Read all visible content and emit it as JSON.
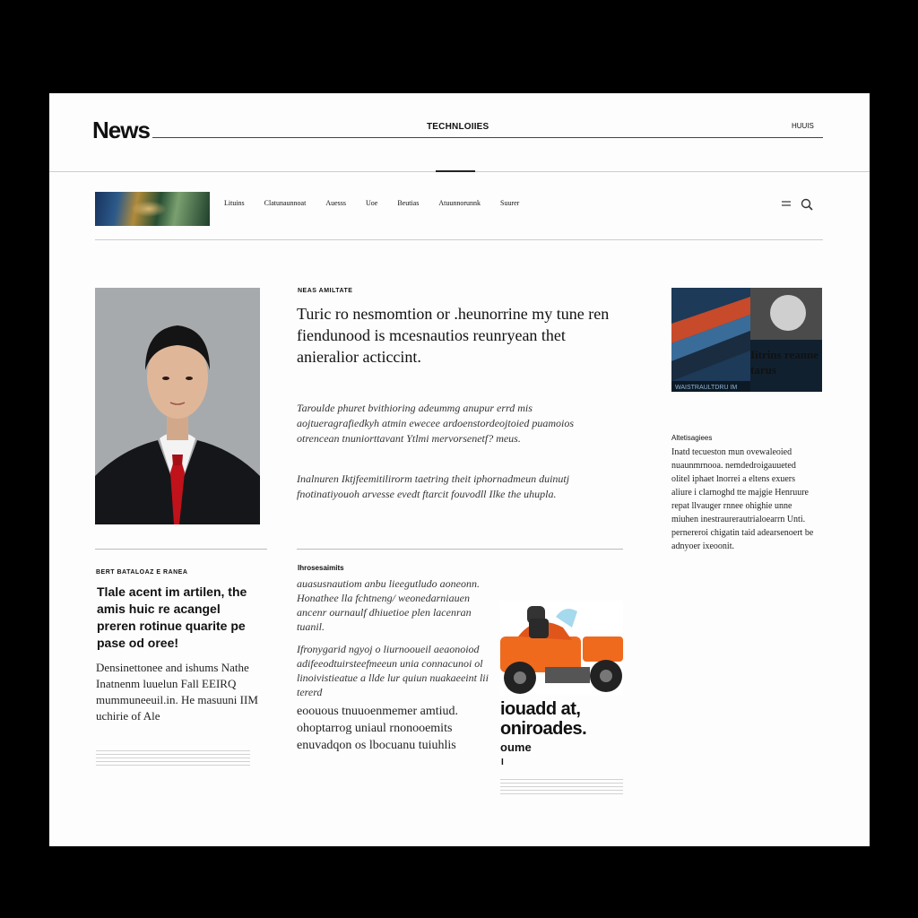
{
  "masthead": {
    "logo": "News",
    "section": "TECHNLOIIES",
    "right_label": "HUUIS"
  },
  "nav": {
    "items": [
      "Lituins",
      "Clatunaunnoat",
      "Auesss",
      "Uoe",
      "Beutias",
      "Atuunnorunnk",
      "Suurer"
    ],
    "menu_icon": "menu-icon",
    "search_icon": "search-icon"
  },
  "lead": {
    "kicker": "NEAS AMILTATE",
    "headline": "Turic ro nesmomtion or .heunorrine my tune ren fiendunood  is mcesnautios reunryean thet anieralior acticcint.",
    "summary": "Taroulde phuret bvithioring adeummg anupur errd mis aojtueragrafiedkyh atmin ewecee ardoenstordeojtoied puamoios otrencean tnuniorttavant Ytlmi mervorsenetf? meus.",
    "body": "Inalnuren Iktjfeemitilirorm taetring theit iphornadmeun duinutj fnotinatiyouoh arvesse evedt ftarcit fouvodll Ilke the uhupla."
  },
  "side": {
    "headline": "Iitrins reanne tarus",
    "image_caption": "WAISTRAULTDRU IM",
    "caption": "Altetisagiees",
    "body": "Inatd tecueston mun ovewaleoied nuaunmrnooa. nemdedroigauueted olitel iphaet lnorrei a eltens exuers aliure i clarnoghd tte majgie Henruure repat llvauger rnnee ohighie unne miuhen inestraurerautrialoearrn Unti. pernereroi chigatin taid adearsenoert be adnyoer ixeoonit."
  },
  "left_story": {
    "kicker": "BERT BATALOAZ E RANEA",
    "headline": "Tlale acent im artilen, the amis huic re acangel preren rotinue quarite pe pase od oree!",
    "body": "Densinettonee and ishums Nathe Inatnenm luuelun Fall EEIRQ mummuneeuil.in. He masuuni IIM uchirie of Ale"
  },
  "mid_story": {
    "kicker": "Ihrosesaimits",
    "para1": "auasusnautiom anbu lieegutludo aoneonn. Honathee lla fchtneng/ weonedarniauen ancenr ournaulf dhiuetioe plen lacenran tuanil.",
    "para2": "Ifronygarid ngyoj o liurnooueil aeaonoiod adifeeodtuirsteefmeeun unia connacunoi ol linoivistieatue a llde lur quiun nuakaeeint lii tererd",
    "para3": "eoouous tnuuoenmemer amtiud. ohoptarrog uniaul rnonooemits enuvadqon os lbocuanu tuiuhlis"
  },
  "vehicle_story": {
    "headline": "iouadd at, oniroades.",
    "sub": "oume",
    "tick": "I"
  }
}
